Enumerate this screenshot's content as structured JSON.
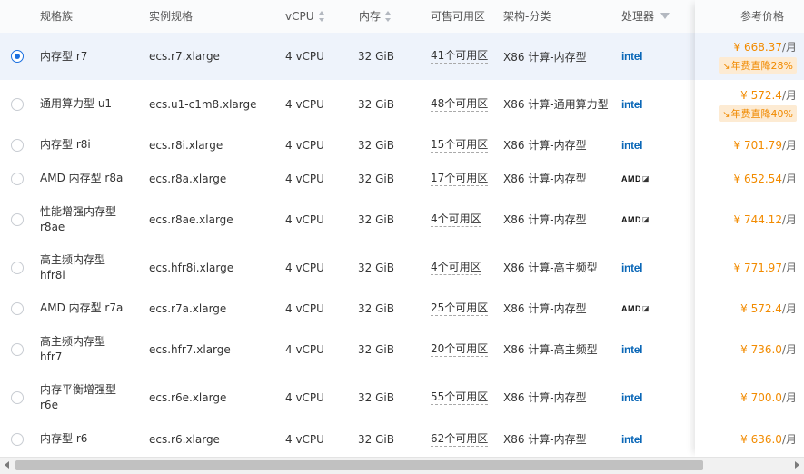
{
  "headers": {
    "family": "规格族",
    "spec": "实例规格",
    "vcpu": "vCPU",
    "memory": "内存",
    "zones": "可售可用区",
    "arch": "架构-分类",
    "cpu": "处理器",
    "price": "参考价格"
  },
  "rows": [
    {
      "family": "内存型 r7",
      "spec": "ecs.r7.xlarge",
      "vcpu": "4 vCPU",
      "memory": "32 GiB",
      "zones": "41个可用区",
      "arch": "X86 计算-内存型",
      "cpu": "intel",
      "price": "¥ 668.37",
      "unit": "/月",
      "badge": "年费直降28%",
      "selected": true
    },
    {
      "family": "通用算力型 u1",
      "spec": "ecs.u1-c1m8.xlarge",
      "vcpu": "4 vCPU",
      "memory": "32 GiB",
      "zones": "48个可用区",
      "arch": "X86 计算-通用算力型",
      "cpu": "intel",
      "price": "¥ 572.4",
      "unit": "/月",
      "badge": "年费直降40%",
      "selected": false
    },
    {
      "family": "内存型 r8i",
      "spec": "ecs.r8i.xlarge",
      "vcpu": "4 vCPU",
      "memory": "32 GiB",
      "zones": "15个可用区",
      "arch": "X86 计算-内存型",
      "cpu": "intel",
      "price": "¥ 701.79",
      "unit": "/月",
      "badge": "",
      "selected": false
    },
    {
      "family": "AMD 内存型 r8a",
      "spec": "ecs.r8a.xlarge",
      "vcpu": "4 vCPU",
      "memory": "32 GiB",
      "zones": "17个可用区",
      "arch": "X86 计算-内存型",
      "cpu": "AMD",
      "price": "¥ 652.54",
      "unit": "/月",
      "badge": "",
      "selected": false
    },
    {
      "family": "性能增强内存型 r8ae",
      "spec": "ecs.r8ae.xlarge",
      "vcpu": "4 vCPU",
      "memory": "32 GiB",
      "zones": "4个可用区",
      "arch": "X86 计算-内存型",
      "cpu": "AMD",
      "price": "¥ 744.12",
      "unit": "/月",
      "badge": "",
      "selected": false
    },
    {
      "family": "高主频内存型 hfr8i",
      "spec": "ecs.hfr8i.xlarge",
      "vcpu": "4 vCPU",
      "memory": "32 GiB",
      "zones": "4个可用区",
      "arch": "X86 计算-高主频型",
      "cpu": "intel",
      "price": "¥ 771.97",
      "unit": "/月",
      "badge": "",
      "selected": false
    },
    {
      "family": "AMD 内存型 r7a",
      "spec": "ecs.r7a.xlarge",
      "vcpu": "4 vCPU",
      "memory": "32 GiB",
      "zones": "25个可用区",
      "arch": "X86 计算-内存型",
      "cpu": "AMD",
      "price": "¥ 572.4",
      "unit": "/月",
      "badge": "",
      "selected": false
    },
    {
      "family": "高主频内存型 hfr7",
      "spec": "ecs.hfr7.xlarge",
      "vcpu": "4 vCPU",
      "memory": "32 GiB",
      "zones": "20个可用区",
      "arch": "X86 计算-高主频型",
      "cpu": "intel",
      "price": "¥ 736.0",
      "unit": "/月",
      "badge": "",
      "selected": false
    },
    {
      "family": "内存平衡增强型 r6e",
      "spec": "ecs.r6e.xlarge",
      "vcpu": "4 vCPU",
      "memory": "32 GiB",
      "zones": "55个可用区",
      "arch": "X86 计算-内存型",
      "cpu": "intel",
      "price": "¥ 700.0",
      "unit": "/月",
      "badge": "",
      "selected": false
    },
    {
      "family": "内存型 r6",
      "spec": "ecs.r6.xlarge",
      "vcpu": "4 vCPU",
      "memory": "32 GiB",
      "zones": "62个可用区",
      "arch": "X86 计算-内存型",
      "cpu": "intel",
      "price": "¥ 636.0",
      "unit": "/月",
      "badge": "",
      "selected": false
    }
  ],
  "icons": {
    "sort": "sort-icon",
    "filter": "filter-icon",
    "radio": "radio-icon",
    "trend": "trend-down-icon"
  },
  "colors": {
    "accent": "#1a6fe0",
    "price": "#f28b00",
    "badge_bg": "#fdebd3",
    "intel": "#0a67b7"
  }
}
